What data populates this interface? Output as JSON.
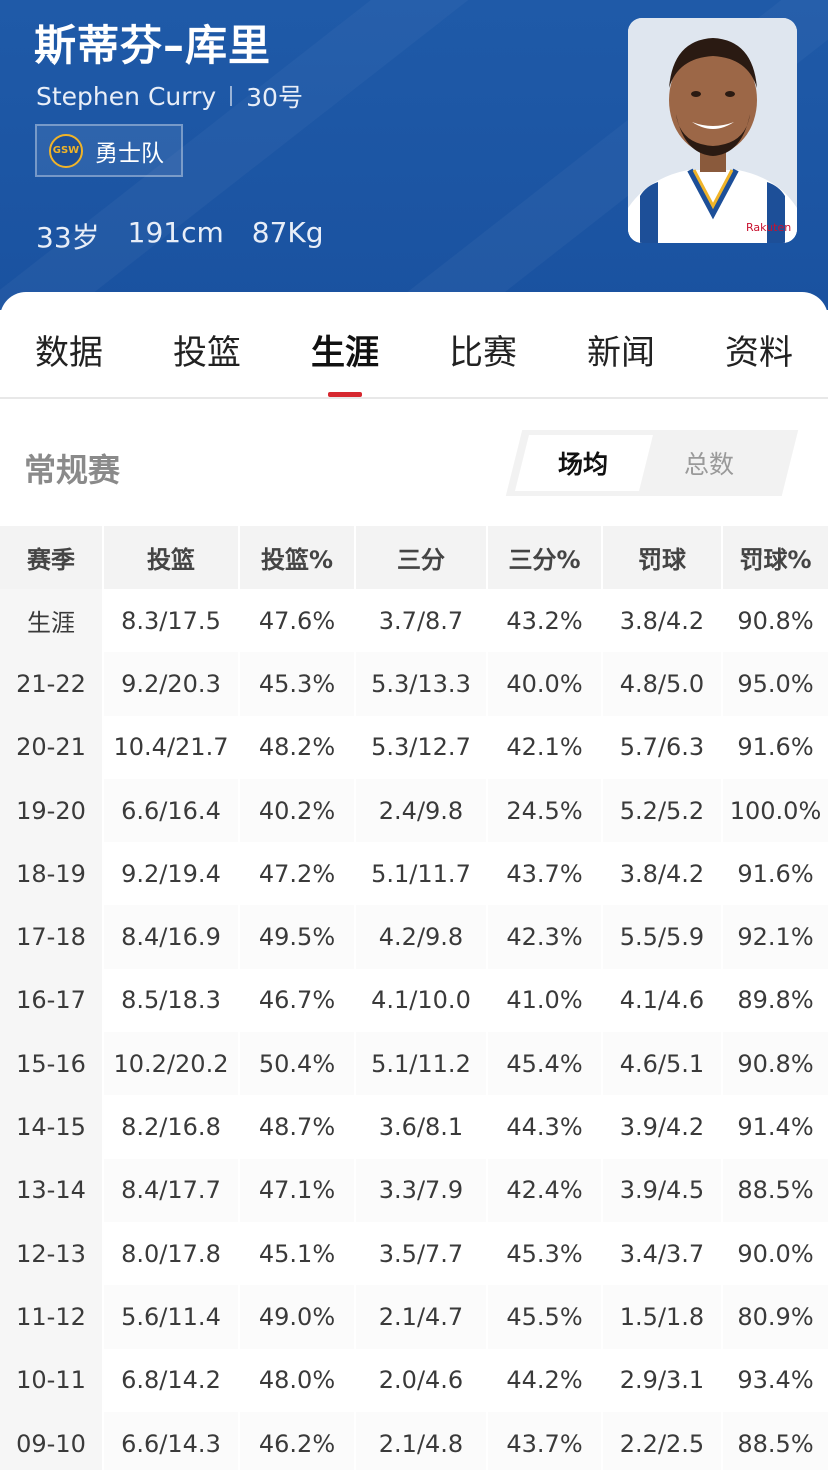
{
  "player": {
    "name_cn": "斯蒂芬–库里",
    "name_en": "Stephen Curry",
    "number": "30号",
    "team_logo_text": "GSW",
    "team": "勇士队",
    "age": "33岁",
    "height": "191cm",
    "weight": "87Kg"
  },
  "tabs": [
    {
      "label": "数据",
      "active": false
    },
    {
      "label": "投篮",
      "active": false
    },
    {
      "label": "生涯",
      "active": true
    },
    {
      "label": "比赛",
      "active": false
    },
    {
      "label": "新闻",
      "active": false
    },
    {
      "label": "资料",
      "active": false
    }
  ],
  "section": {
    "title": "常规赛",
    "toggle_selected": "场均",
    "toggle_other": "总数"
  },
  "table": {
    "headers": [
      "赛季",
      "投篮",
      "投篮%",
      "三分",
      "三分%",
      "罚球",
      "罚球%"
    ],
    "rows": [
      [
        "生涯",
        "8.3/17.5",
        "47.6%",
        "3.7/8.7",
        "43.2%",
        "3.8/4.2",
        "90.8%"
      ],
      [
        "21-22",
        "9.2/20.3",
        "45.3%",
        "5.3/13.3",
        "40.0%",
        "4.8/5.0",
        "95.0%"
      ],
      [
        "20-21",
        "10.4/21.7",
        "48.2%",
        "5.3/12.7",
        "42.1%",
        "5.7/6.3",
        "91.6%"
      ],
      [
        "19-20",
        "6.6/16.4",
        "40.2%",
        "2.4/9.8",
        "24.5%",
        "5.2/5.2",
        "100.0%"
      ],
      [
        "18-19",
        "9.2/19.4",
        "47.2%",
        "5.1/11.7",
        "43.7%",
        "3.8/4.2",
        "91.6%"
      ],
      [
        "17-18",
        "8.4/16.9",
        "49.5%",
        "4.2/9.8",
        "42.3%",
        "5.5/5.9",
        "92.1%"
      ],
      [
        "16-17",
        "8.5/18.3",
        "46.7%",
        "4.1/10.0",
        "41.0%",
        "4.1/4.6",
        "89.8%"
      ],
      [
        "15-16",
        "10.2/20.2",
        "50.4%",
        "5.1/11.2",
        "45.4%",
        "4.6/5.1",
        "90.8%"
      ],
      [
        "14-15",
        "8.2/16.8",
        "48.7%",
        "3.6/8.1",
        "44.3%",
        "3.9/4.2",
        "91.4%"
      ],
      [
        "13-14",
        "8.4/17.7",
        "47.1%",
        "3.3/7.9",
        "42.4%",
        "3.9/4.5",
        "88.5%"
      ],
      [
        "12-13",
        "8.0/17.8",
        "45.1%",
        "3.5/7.7",
        "45.3%",
        "3.4/3.7",
        "90.0%"
      ],
      [
        "11-12",
        "5.6/11.4",
        "49.0%",
        "2.1/4.7",
        "45.5%",
        "1.5/1.8",
        "80.9%"
      ],
      [
        "10-11",
        "6.8/14.2",
        "48.0%",
        "2.0/4.6",
        "44.2%",
        "2.9/3.1",
        "93.4%"
      ],
      [
        "09-10",
        "6.6/14.3",
        "46.2%",
        "2.1/4.8",
        "43.7%",
        "2.2/2.5",
        "88.5%"
      ]
    ]
  },
  "colors": {
    "header_bg": "#1f5aa8",
    "tab_indicator": "#d6272f",
    "team_accent": "#f0b429",
    "jersey_blue": "#1d4f98"
  }
}
